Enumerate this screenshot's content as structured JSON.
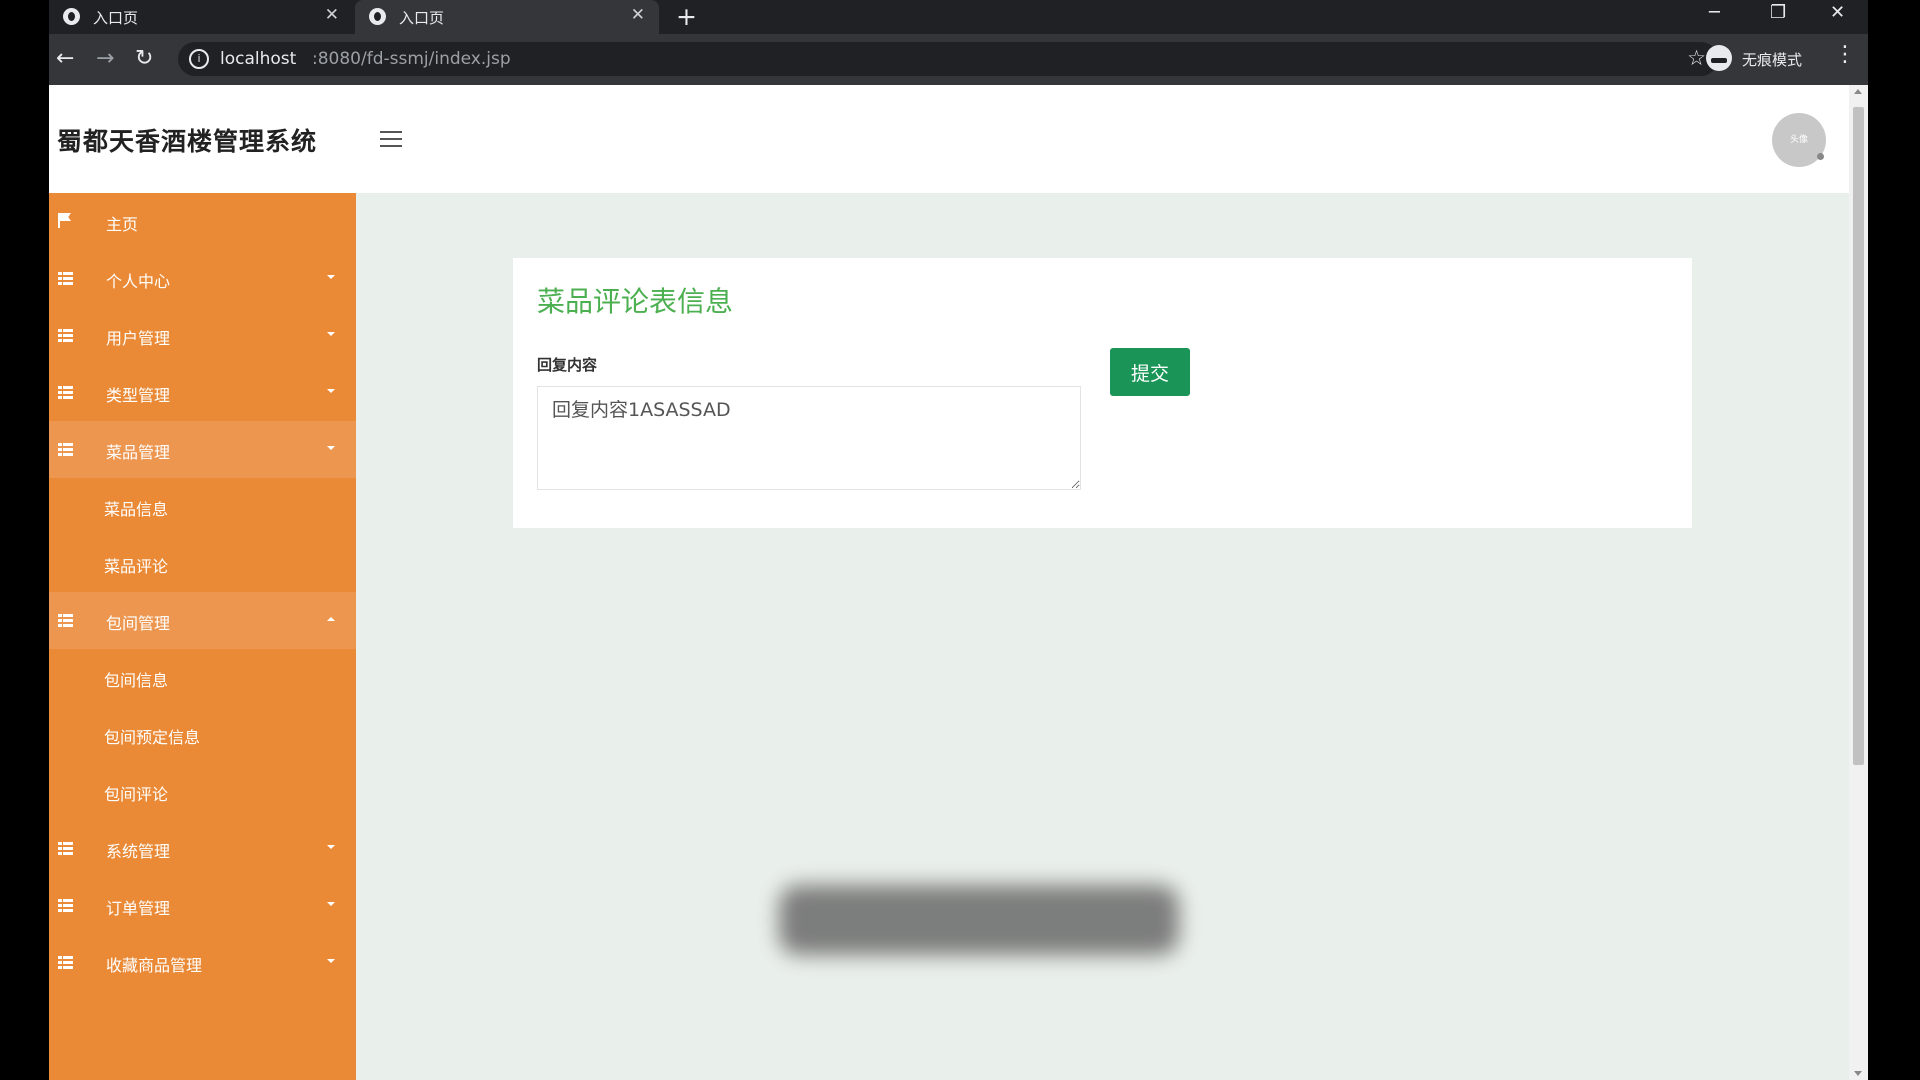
{
  "browser": {
    "tabs": [
      {
        "title": "入口页",
        "close": "✕"
      },
      {
        "title": "入口页",
        "close": "✕"
      }
    ],
    "new_tab": "+",
    "url_host": "localhost",
    "url_rest": ":8080/fd-ssmj/index.jsp",
    "incognito_label": "无痕模式",
    "window_controls": {
      "minimize": "─",
      "restore": "❐",
      "close": "✕"
    }
  },
  "header": {
    "brand": "蜀都天香酒楼管理系统",
    "avatar_text": "头像"
  },
  "sidebar": {
    "items": [
      {
        "label": "主页",
        "icon": "flag-icon"
      },
      {
        "label": "个人中心",
        "icon": "grid-icon"
      },
      {
        "label": "用户管理",
        "icon": "grid-icon"
      },
      {
        "label": "类型管理",
        "icon": "grid-icon"
      },
      {
        "label": "菜品管理",
        "icon": "grid-icon"
      },
      {
        "label": "菜品信息"
      },
      {
        "label": "菜品评论"
      },
      {
        "label": "包间管理",
        "icon": "grid-icon"
      },
      {
        "label": "包间信息"
      },
      {
        "label": "包间预定信息"
      },
      {
        "label": "包间评论"
      },
      {
        "label": "系统管理",
        "icon": "grid-icon"
      },
      {
        "label": "订单管理",
        "icon": "grid-icon"
      },
      {
        "label": "收藏商品管理",
        "icon": "grid-icon"
      }
    ]
  },
  "form": {
    "title": "菜品评论表信息",
    "field_label": "回复内容",
    "field_value": "回复内容1ASASSAD",
    "submit_label": "提交"
  },
  "colors": {
    "sidebar_bg": "#ea8a36",
    "accent_green": "#4caf50",
    "submit_bg": "#1b9557"
  }
}
